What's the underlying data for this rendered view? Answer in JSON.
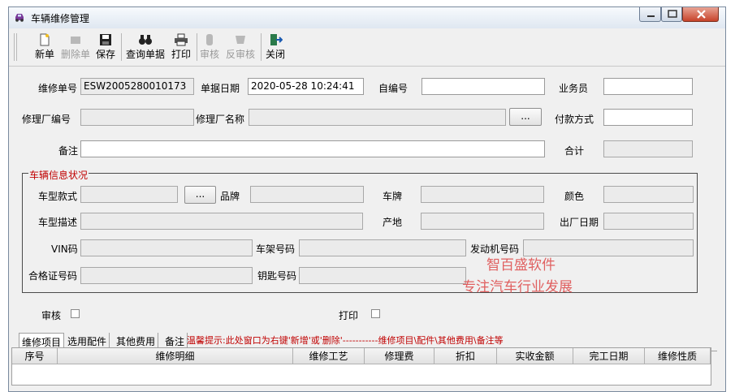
{
  "window": {
    "title": "车辆维修管理"
  },
  "toolbar": {
    "new": "新单",
    "delete": "删除单",
    "save": "保存",
    "query": "查询单据",
    "print": "打印",
    "audit": "审核",
    "unaudit": "反审核",
    "close": "关闭"
  },
  "form": {
    "order_no_label": "维修单号",
    "order_no": "ESW2005280010173",
    "date_label": "单据日期",
    "date": "2020-05-28 10:24:41",
    "self_no_label": "自编号",
    "self_no": "",
    "salesman_label": "业务员",
    "salesman": "",
    "factory_code_label": "修理厂编号",
    "factory_code": "",
    "factory_name_label": "修理厂名称",
    "factory_name": "",
    "browse": "...",
    "payment_label": "付款方式",
    "payment": "",
    "remark_label": "备注",
    "remark": "",
    "total_label": "合计",
    "total": ""
  },
  "vehicle": {
    "group_title": "车辆信息状况",
    "model_label": "车型款式",
    "model": "",
    "browse": "...",
    "brand_label": "品牌",
    "brand": "",
    "plate_label": "车牌",
    "plate": "",
    "color_label": "颜色",
    "color": "",
    "desc_label": "车型描述",
    "desc": "",
    "origin_label": "产地",
    "origin": "",
    "mfg_date_label": "出厂日期",
    "mfg_date": "",
    "vin_label": "VIN码",
    "vin": "",
    "frame_label": "车架号码",
    "frame": "",
    "engine_label": "发动机号码",
    "engine": "",
    "cert_label": "合格证号码",
    "cert": "",
    "key_label": "钥匙号码",
    "key": ""
  },
  "watermark": {
    "line1": "智百盛软件",
    "line2": "专注汽车行业发展"
  },
  "checks": {
    "audit_label": "审核",
    "print_label": "打印"
  },
  "tabs": [
    "维修项目",
    "选用配件",
    "其他费用",
    "备注"
  ],
  "tip": "温馨提示:此处窗口为右键'新增'或'删除'-----------维修项目\\配件\\其他费用\\备注等",
  "grid": {
    "columns": [
      "序号",
      "维修明细",
      "维修工艺",
      "修理费",
      "折扣",
      "实收金额",
      "完工日期",
      "维修性质"
    ]
  }
}
